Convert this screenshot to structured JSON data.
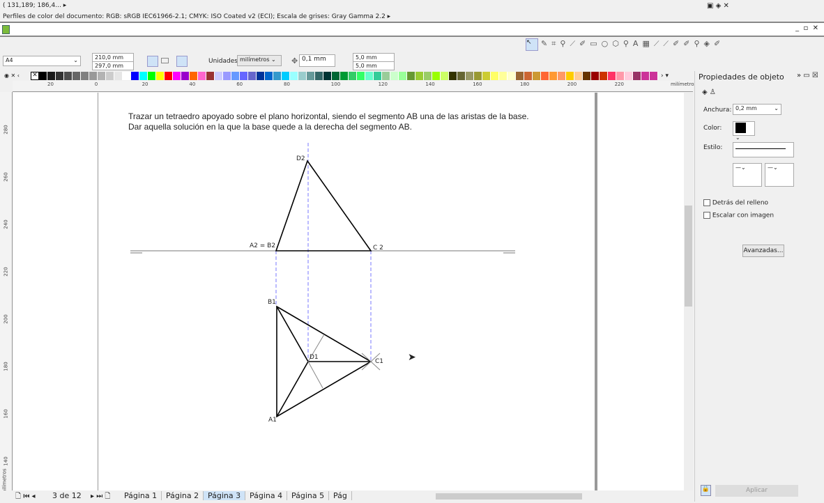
{
  "status": {
    "coords": "( 131,189; 186,4...",
    "color_profiles": "Perfiles de color del documento: RGB: sRGB IEC61966-2.1; CMYK: ISO Coated v2 (ECI); Escala de grises: Gray Gamma 2.2"
  },
  "propbar": {
    "page_size": "A4",
    "width": "210,0 mm",
    "height": "297,0 mm",
    "units_label": "Unidades:",
    "units": "milímetros",
    "nudge": "0,1 mm",
    "dup_x": "5,0 mm",
    "dup_y": "5,0 mm"
  },
  "palette": [
    "#000000",
    "#1a1a1a",
    "#333333",
    "#4d4d4d",
    "#666666",
    "#808080",
    "#999999",
    "#b3b3b3",
    "#cccccc",
    "#e6e6e6",
    "#ffffff",
    "#0000ff",
    "#00ffff",
    "#00ff00",
    "#ffff00",
    "#ff0000",
    "#ff00ff",
    "#9900cc",
    "#ff6600",
    "#ff66cc",
    "#993333",
    "#ccccff",
    "#9999ff",
    "#6699ff",
    "#6666ff",
    "#6666cc",
    "#003399",
    "#0066cc",
    "#3399cc",
    "#00ccff",
    "#99ffff",
    "#99cccc",
    "#669999",
    "#336666",
    "#003333",
    "#006633",
    "#009933",
    "#33cc66",
    "#33ff66",
    "#66ffcc",
    "#33cc99",
    "#99cc99",
    "#ccffcc",
    "#99ff99",
    "#669933",
    "#99cc33",
    "#99cc66",
    "#99ff00",
    "#ccff66",
    "#333300",
    "#666633",
    "#999966",
    "#999933",
    "#cccc33",
    "#ffff66",
    "#ffff99",
    "#ffffcc",
    "#996633",
    "#cc6633",
    "#cc9933",
    "#ff6633",
    "#ff9933",
    "#ff9966",
    "#ffcc00",
    "#ffcc99",
    "#663300",
    "#990000",
    "#cc3300",
    "#ff3366",
    "#ff99aa",
    "#ffccdd",
    "#993366",
    "#cc3399",
    "#cc3399"
  ],
  "ruler": {
    "h_ticks": [
      "20",
      "0",
      "20",
      "40",
      "60",
      "80",
      "100",
      "120",
      "140",
      "160",
      "180",
      "200",
      "220"
    ],
    "h_unit": "milímetros",
    "v_ticks": [
      "280",
      "260",
      "240",
      "220",
      "200",
      "180",
      "160",
      "140"
    ],
    "v_unit": "milímetros"
  },
  "drawing": {
    "line1": "Trazar un tetraedro apoyado sobre el plano horizontal, siendo el segmento AB una de las aristas de la base.",
    "line2": "Dar aquella solución en la que la base quede a la derecha del segmento AB.",
    "labels": {
      "d2": "D2",
      "a2b2": "A2 = B2",
      "c2": "C 2",
      "b1": "B1",
      "d1": "D1",
      "c1": "C1",
      "a1": "A1"
    }
  },
  "pages": {
    "counter": "3 de 12",
    "tabs": [
      "Página 1",
      "Página 2",
      "Página 3",
      "Página 4",
      "Página 5",
      "Pág"
    ],
    "active": 2
  },
  "panel": {
    "title": "Propiedades de objeto",
    "width_label": "Anchura:",
    "width_value": "0,2 mm",
    "color_label": "Color:",
    "color_value": "#000000",
    "style_label": "Estilo:",
    "behind_fill": "Detrás del relleno",
    "scale_with_image": "Escalar con imagen",
    "advanced": "Avanzadas...",
    "apply": "Aplicar"
  }
}
